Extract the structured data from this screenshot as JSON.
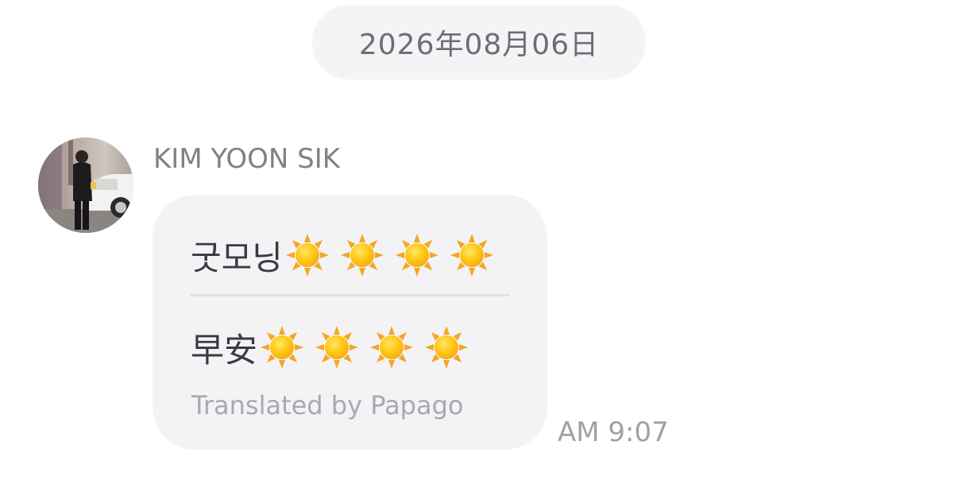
{
  "chat": {
    "date_label": "2026年08月06日"
  },
  "message": {
    "sender_name": "KIM YOON SIK",
    "original_text": "굿모닝",
    "translated_text": "早安",
    "emoji_icon": "sun-icon",
    "emoji_count": 4,
    "attribution": "Translated by Papago",
    "time": "AM 9:07"
  },
  "colors": {
    "bubble_background": "#f3f3f5",
    "date_pill_background": "#f4f4f6",
    "sun_yellow": "#ffc40c",
    "sun_orange": "#f5a623"
  }
}
